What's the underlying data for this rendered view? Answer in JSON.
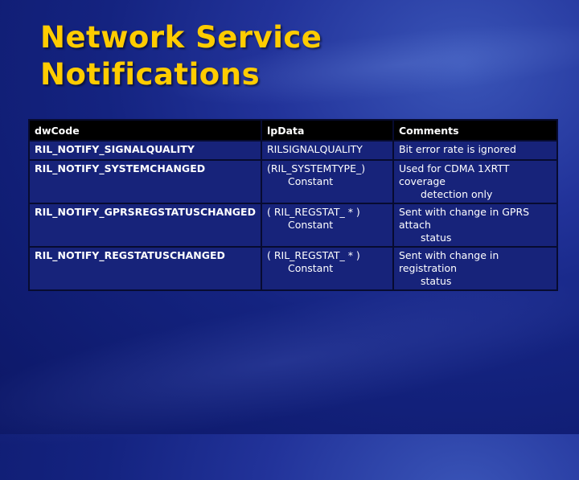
{
  "slide": {
    "title_line1": "Network Service",
    "title_line2": "Notifications"
  },
  "table": {
    "headers": [
      "dwCode",
      "lpData",
      "Comments"
    ],
    "rows": [
      {
        "code": "RIL_NOTIFY_SIGNALQUALITY",
        "lpdata_line1": "RILSIGNALQUALITY",
        "lpdata_line2": "",
        "comment_line1": "Bit error rate is ignored",
        "comment_line2": ""
      },
      {
        "code": "RIL_NOTIFY_SYSTEMCHANGED",
        "lpdata_line1": "(RIL_SYSTEMTYPE_)",
        "lpdata_line2": "Constant",
        "comment_line1": "Used for CDMA 1XRTT coverage",
        "comment_line2": "detection only"
      },
      {
        "code": "RIL_NOTIFY_GPRSREGSTATUSCHANGED",
        "lpdata_line1": "( RIL_REGSTAT_ * )",
        "lpdata_line2": "Constant",
        "comment_line1": "Sent with change in GPRS attach",
        "comment_line2": "status"
      },
      {
        "code": "RIL_NOTIFY_REGSTATUSCHANGED",
        "lpdata_line1": "( RIL_REGSTAT_ * )",
        "lpdata_line2": "Constant",
        "comment_line1": "Sent with  change in registration",
        "comment_line2": "status"
      }
    ]
  },
  "colors": {
    "title": "#ffcc00",
    "background": "#142380",
    "header_bg": "#000000",
    "cell_bg": "#17237a",
    "text": "#ffffff"
  }
}
